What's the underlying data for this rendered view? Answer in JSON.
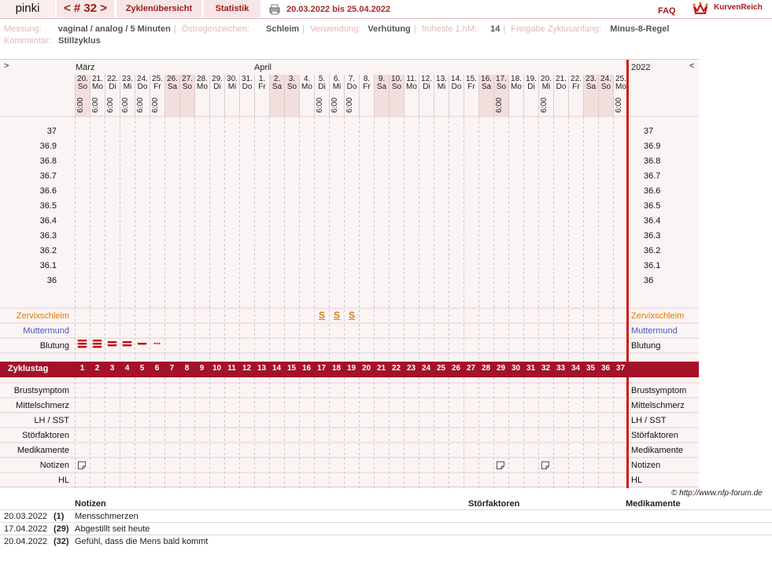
{
  "nav": {
    "user": "pinki",
    "cycle_nav": "< # 32 >",
    "overview": "Zyklenübersicht",
    "stats": "Statistik",
    "date_range": "20.03.2022 bis 25.04.2022",
    "faq": "FAQ",
    "logo": "KurvenReich"
  },
  "info": {
    "measurement_label": "Messung:",
    "measurement": "vaginal / analog / 5 Minuten",
    "estrogen_label": "Östrogenzeichen:",
    "estrogen": "Schleim",
    "usage_label": "Verwendung:",
    "usage": "Verhütung",
    "earliest_label": "früheste 1.hM:",
    "earliest": "14",
    "release_label": "Freigabe Zyklusanfang:",
    "release": "Minus-8-Regel",
    "comment_label": "Kommentar:",
    "comment": "Stillzyklus"
  },
  "chart": {
    "left_arrow": ">",
    "right_arrow": "<",
    "month1": "März",
    "month2": "April",
    "year": "2022",
    "days": [
      {
        "d": "20.",
        "w": "So",
        "t": "6:00"
      },
      {
        "d": "21.",
        "w": "Mo",
        "t": "6:00"
      },
      {
        "d": "22.",
        "w": "Di",
        "t": "6:00"
      },
      {
        "d": "23.",
        "w": "Mi",
        "t": "6:00"
      },
      {
        "d": "24.",
        "w": "Do",
        "t": "6:00"
      },
      {
        "d": "25.",
        "w": "Fr",
        "t": "6:00"
      },
      {
        "d": "26.",
        "w": "Sa",
        "t": ""
      },
      {
        "d": "27.",
        "w": "So",
        "t": ""
      },
      {
        "d": "28.",
        "w": "Mo",
        "t": ""
      },
      {
        "d": "29.",
        "w": "Di",
        "t": ""
      },
      {
        "d": "30.",
        "w": "Mi",
        "t": ""
      },
      {
        "d": "31.",
        "w": "Do",
        "t": ""
      },
      {
        "d": "1.",
        "w": "Fr",
        "t": ""
      },
      {
        "d": "2.",
        "w": "Sa",
        "t": ""
      },
      {
        "d": "3.",
        "w": "So",
        "t": ""
      },
      {
        "d": "4.",
        "w": "Mo",
        "t": ""
      },
      {
        "d": "5.",
        "w": "Di",
        "t": "6:00"
      },
      {
        "d": "6.",
        "w": "Mi",
        "t": "6:00"
      },
      {
        "d": "7.",
        "w": "Do",
        "t": "6:00"
      },
      {
        "d": "8.",
        "w": "Fr",
        "t": ""
      },
      {
        "d": "9.",
        "w": "Sa",
        "t": ""
      },
      {
        "d": "10.",
        "w": "So",
        "t": ""
      },
      {
        "d": "11.",
        "w": "Mo",
        "t": ""
      },
      {
        "d": "12.",
        "w": "Di",
        "t": ""
      },
      {
        "d": "13.",
        "w": "Mi",
        "t": ""
      },
      {
        "d": "14.",
        "w": "Do",
        "t": ""
      },
      {
        "d": "15.",
        "w": "Fr",
        "t": ""
      },
      {
        "d": "16.",
        "w": "Sa",
        "t": ""
      },
      {
        "d": "17.",
        "w": "So",
        "t": "6:00"
      },
      {
        "d": "18.",
        "w": "Mo",
        "t": ""
      },
      {
        "d": "19.",
        "w": "Di",
        "t": ""
      },
      {
        "d": "20.",
        "w": "Mi",
        "t": "6:00"
      },
      {
        "d": "21.",
        "w": "Do",
        "t": ""
      },
      {
        "d": "22.",
        "w": "Fr",
        "t": ""
      },
      {
        "d": "23.",
        "w": "Sa",
        "t": ""
      },
      {
        "d": "24.",
        "w": "So",
        "t": ""
      },
      {
        "d": "25.",
        "w": "Mo",
        "t": "6:00"
      }
    ],
    "temps": [
      "37",
      "36.9",
      "36.8",
      "36.7",
      "36.6",
      "36.5",
      "36.4",
      "36.3",
      "36.2",
      "36.1",
      "36"
    ],
    "rows_top": [
      "Zervixschleim",
      "Muttermund",
      "Blutung"
    ],
    "cycle_label": "Zyklustag",
    "rows_bottom": [
      "Brustsymptom",
      "Mittelschmerz",
      "LH / SST",
      "Störfaktoren",
      "Medikamente",
      "Notizen",
      "HL"
    ],
    "mucus_symbol": "S",
    "mucus_days": [
      16,
      17,
      18
    ],
    "bleeding": [
      3,
      3,
      2,
      2,
      1,
      0.5
    ],
    "note_days": [
      0,
      28,
      31
    ],
    "colors": {
      "zervix": "#e07b00",
      "muttermund": "#4a55c8",
      "bar": "#a4122a",
      "blood": "#c0101a",
      "divider": "#d01818"
    }
  },
  "copyright": "© http://www.nfp-forum.de",
  "notes": {
    "h_notes": "Notizen",
    "h_stoer": "Störfaktoren",
    "h_med": "Medikamente",
    "rows": [
      {
        "date": "20.03.2022",
        "day": "(1)",
        "text": "Mensschmerzen"
      },
      {
        "date": "17.04.2022",
        "day": "(29)",
        "text": "Abgestillt seit heute"
      },
      {
        "date": "20.04.2022",
        "day": "(32)",
        "text": "Gefühl, dass die Mens bald kommt"
      }
    ]
  }
}
